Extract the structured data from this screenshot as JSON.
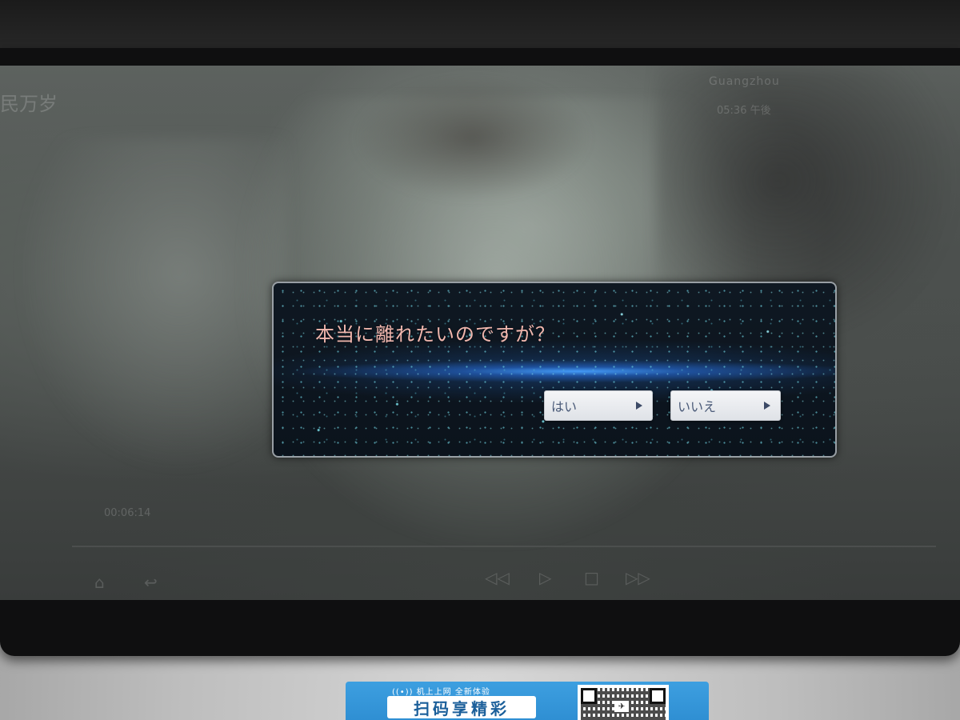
{
  "screen": {
    "ghost_title": "民万岁",
    "ghost_route": "Guangzhou",
    "ghost_time": "05:36 午後",
    "elapsed": "00:06:14"
  },
  "dialog": {
    "message": "本当に離れたいのですが？",
    "yes_label": "はい",
    "no_label": "いいえ"
  },
  "controls": {
    "home_icon": "home-icon",
    "back_icon": "back-icon",
    "rewind_icon": "rewind-icon",
    "play_icon": "play-icon",
    "stop_icon": "stop-icon",
    "forward_icon": "fast-forward-icon"
  },
  "placard": {
    "top_text": "((•)) 机上上网   全新体验",
    "main_text": "扫码享精彩"
  }
}
